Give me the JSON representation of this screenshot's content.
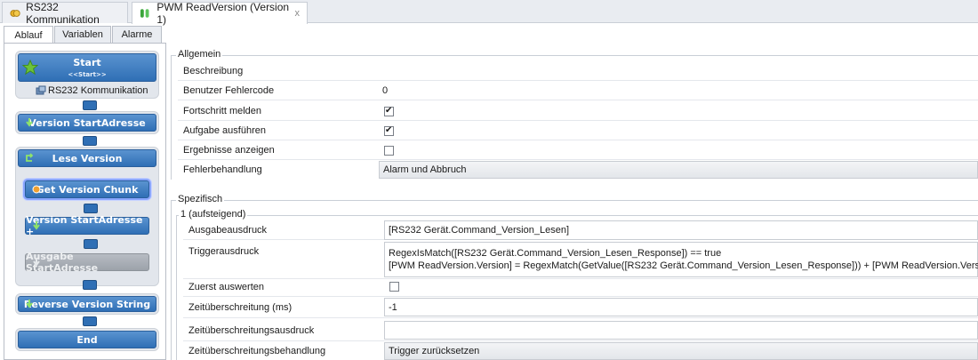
{
  "doc_tabs": [
    {
      "label": "RS232 Kommunikation",
      "icon": "plug-icon"
    },
    {
      "label": "PWM ReadVersion (Version 1)",
      "icon": "flow-icon",
      "close": "x"
    }
  ],
  "sub_tabs": [
    "Ablauf",
    "Variablen",
    "Alarme"
  ],
  "flow": {
    "start": {
      "label": "Start",
      "sub": "<<Start>>",
      "device": "RS232 Kommunikation"
    },
    "version_start": "Version StartAdresse",
    "lese_version": "Lese Version",
    "get_chunk": "Get Version Chunk",
    "version_plus": "Version StartAdresse +",
    "ausgabe_start": "Ausgabe StartAdresse",
    "reverse": "Reverse Version String",
    "end": "End"
  },
  "allgemein": {
    "title": "Allgemein",
    "beschreibung_label": "Beschreibung",
    "beschreibung_value": "",
    "fehlercode_label": "Benutzer Fehlercode",
    "fehlercode_value": "0",
    "fortschritt_label": "Fortschritt melden",
    "fortschritt_checked": true,
    "aufgabe_label": "Aufgabe ausführen",
    "aufgabe_checked": true,
    "ergebnisse_label": "Ergebnisse anzeigen",
    "ergebnisse_checked": false,
    "fehlerbehandlung_label": "Fehlerbehandlung",
    "fehlerbehandlung_value": "Alarm und Abbruch"
  },
  "spezifisch": {
    "title": "Spezifisch",
    "sub_title": "1 (aufsteigend)",
    "ausgabe_label": "Ausgabeausdruck",
    "ausgabe_value": "[RS232 Gerät.Command_Version_Lesen]",
    "trigger_label": "Triggerausdruck",
    "trigger_line1": "RegexIsMatch([RS232 Gerät.Command_Version_Lesen_Response]) == true",
    "trigger_line2": "[PWM ReadVersion.Version] = RegexMatch(GetValue([RS232 Gerät.Command_Version_Lesen_Response])) + [PWM ReadVersion.Version]",
    "zuerst_label": "Zuerst auswerten",
    "zuerst_checked": false,
    "timeout_label": "Zeitüberschreitung (ms)",
    "timeout_value": "-1",
    "timeout_ausdruck_label": "Zeitüberschreitungsausdruck",
    "timeout_ausdruck_value": "",
    "timeout_behandlung_label": "Zeitüberschreitungsbehandlung",
    "timeout_behandlung_value": "Trigger zurücksetzen"
  }
}
